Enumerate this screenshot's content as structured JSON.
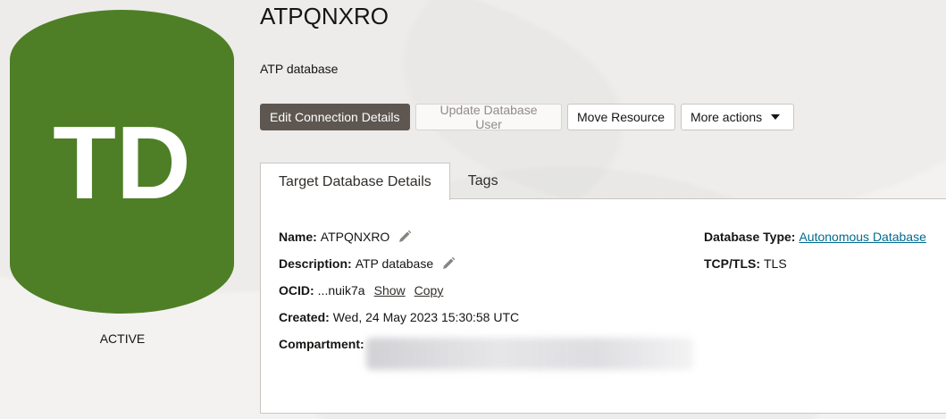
{
  "resource": {
    "icon_initials": "TD",
    "icon_color": "#4e7f26",
    "status": "ACTIVE",
    "title": "ATPQNXRO",
    "subtitle": "ATP database"
  },
  "actions": {
    "edit_connection": "Edit Connection Details",
    "update_user": "Update Database User",
    "move_resource": "Move Resource",
    "more_actions": "More actions"
  },
  "tabs": [
    {
      "label": "Target Database Details",
      "active": true
    },
    {
      "label": "Tags",
      "active": false
    }
  ],
  "details": {
    "name_label": "Name:",
    "name_value": "ATPQNXRO",
    "description_label": "Description:",
    "description_value": "ATP database",
    "ocid_label": "OCID:",
    "ocid_value": "...nuik7a",
    "ocid_show": "Show",
    "ocid_copy": "Copy",
    "created_label": "Created:",
    "created_value": "Wed, 24 May 2023 15:30:58 UTC",
    "compartment_label": "Compartment:",
    "db_type_label": "Database Type:",
    "db_type_value": "Autonomous Database",
    "tcp_label": "TCP/TLS:",
    "tcp_value": "TLS"
  },
  "colors": {
    "primary_button": "#5e5751",
    "link": "#006b8f"
  },
  "icons": {
    "edit": "pencil-icon",
    "dropdown": "caret-down-icon"
  }
}
